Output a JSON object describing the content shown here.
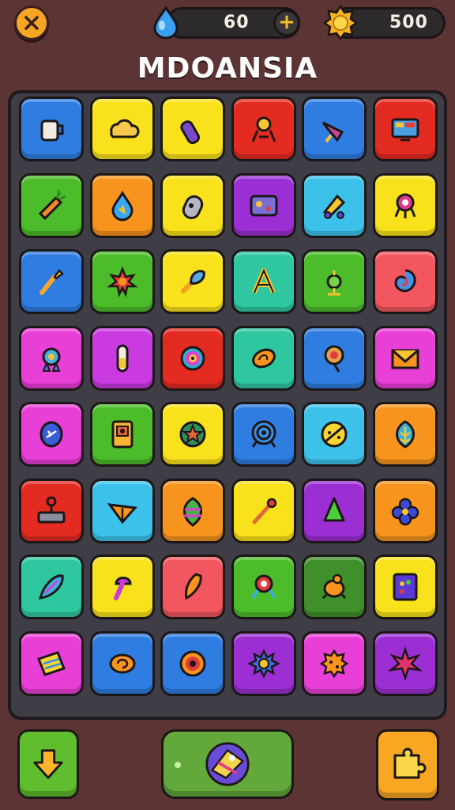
{
  "header": {
    "gems": "60",
    "coins": "500",
    "title": "MDOANSIA"
  },
  "colors": {
    "blue": "#2f7de1",
    "yellow": "#f9e21b",
    "red": "#e32b22",
    "green": "#4cbc2a",
    "orange": "#f7941d",
    "purple": "#9b2fd3",
    "cyan": "#3cc2ea",
    "teal": "#2ec7a0",
    "pink": "#e83fd6",
    "magenta": "#c93ae0",
    "darkgreen": "#3f8f2a",
    "salmon": "#f2565e"
  },
  "board": [
    [
      "blue",
      "yellow",
      "yellow",
      "red",
      "blue",
      "red"
    ],
    [
      "green",
      "orange",
      "yellow",
      "purple",
      "cyan",
      "yellow"
    ],
    [
      "blue",
      "green",
      "yellow",
      "teal",
      "green",
      "salmon"
    ],
    [
      "pink",
      "magenta",
      "red",
      "teal",
      "blue",
      "pink"
    ],
    [
      "pink",
      "green",
      "yellow",
      "blue",
      "cyan",
      "orange"
    ],
    [
      "red",
      "cyan",
      "orange",
      "yellow",
      "purple",
      "orange"
    ],
    [
      "teal",
      "yellow",
      "salmon",
      "green",
      "darkgreen",
      "yellow"
    ],
    [
      "pink",
      "blue",
      "blue",
      "purple",
      "pink",
      "purple"
    ]
  ],
  "icons": [
    [
      "cup-icon",
      "cloud-icon",
      "crayon-icon",
      "robot-legs-icon",
      "horn-icon",
      "monitor-icon"
    ],
    [
      "carrot-icon",
      "water-drop-icon",
      "rocket-icon",
      "map-card-icon",
      "cannon-icon",
      "monster-icon"
    ],
    [
      "torch-icon",
      "sun-icon",
      "paintbrush-icon",
      "letter-a-icon",
      "potion-icon",
      "swirl-shell-icon"
    ],
    [
      "medal-icon",
      "battery-icon",
      "spiral-icon",
      "seed-icon",
      "lollipop-icon",
      "envelope-icon"
    ],
    [
      "egg-icon",
      "machine-icon",
      "star-badge-icon",
      "target-icon",
      "pizza-icon",
      "leaf-icon"
    ],
    [
      "stamp-icon",
      "spinning-top-icon",
      "lantern-icon",
      "wand-icon",
      "tree-icon",
      "flower-icon"
    ],
    [
      "feather-icon",
      "mushroom-icon",
      "chili-icon",
      "eye-bot-icon",
      "turtle-icon",
      "cabinet-icon"
    ],
    [
      "map-icon",
      "snail-icon",
      "donut-icon",
      "gear-icon",
      "cookie-icon",
      "starburst-icon"
    ]
  ],
  "buttons": {
    "down_icon": "arrow-down-icon",
    "center_icon": "shuffle-orb-icon",
    "right_icon": "puzzle-icon"
  }
}
